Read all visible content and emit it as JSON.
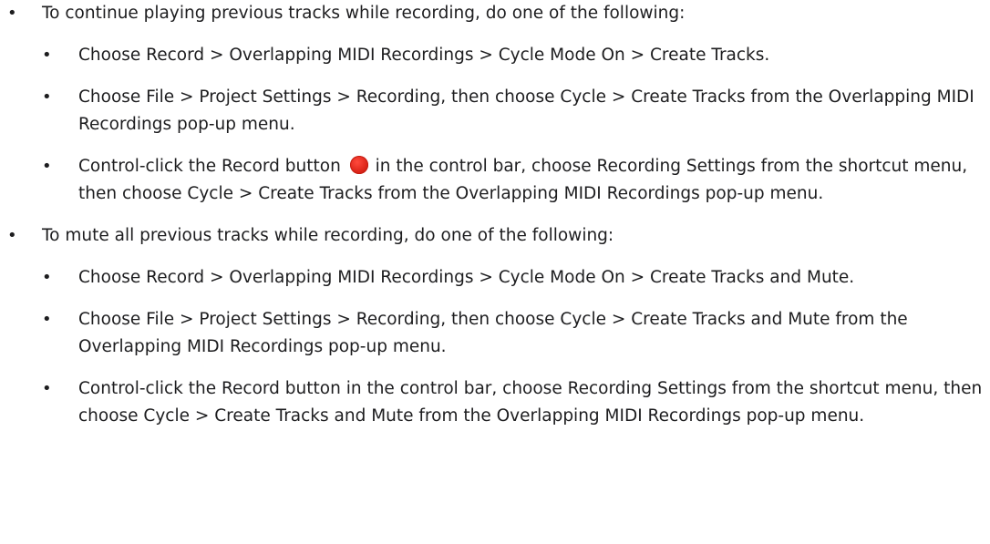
{
  "bullet_glyph": "•",
  "items": [
    {
      "text": "To continue playing previous tracks while recording, do one of the following:",
      "subitems": [
        {
          "text": "Choose Record > Overlapping MIDI Recordings > Cycle Mode On > Create Tracks."
        },
        {
          "text": "Choose File > Project Settings > Recording, then choose Cycle > Create Tracks from the Overlapping MIDI Recordings pop-up menu."
        },
        {
          "text_before_icon": "Control-click the Record button",
          "icon": "record-button-icon",
          "icon_color": "#e0281c",
          "text_after_icon": "in the control bar, choose Recording Settings from the shortcut menu, then choose Cycle > Create Tracks from the Overlapping MIDI Recordings pop-up menu."
        }
      ]
    },
    {
      "text": "To mute all previous tracks while recording, do one of the following:",
      "subitems": [
        {
          "text": "Choose Record > Overlapping MIDI Recordings > Cycle Mode On > Create Tracks and Mute."
        },
        {
          "text": "Choose File > Project Settings > Recording, then choose Cycle > Create Tracks and Mute from the Overlapping MIDI Recordings pop-up menu."
        },
        {
          "text": "Control-click the Record button in the control bar, choose Recording Settings from the shortcut menu, then choose Cycle > Create Tracks and Mute from the Overlapping MIDI Recordings pop-up menu."
        }
      ]
    }
  ]
}
